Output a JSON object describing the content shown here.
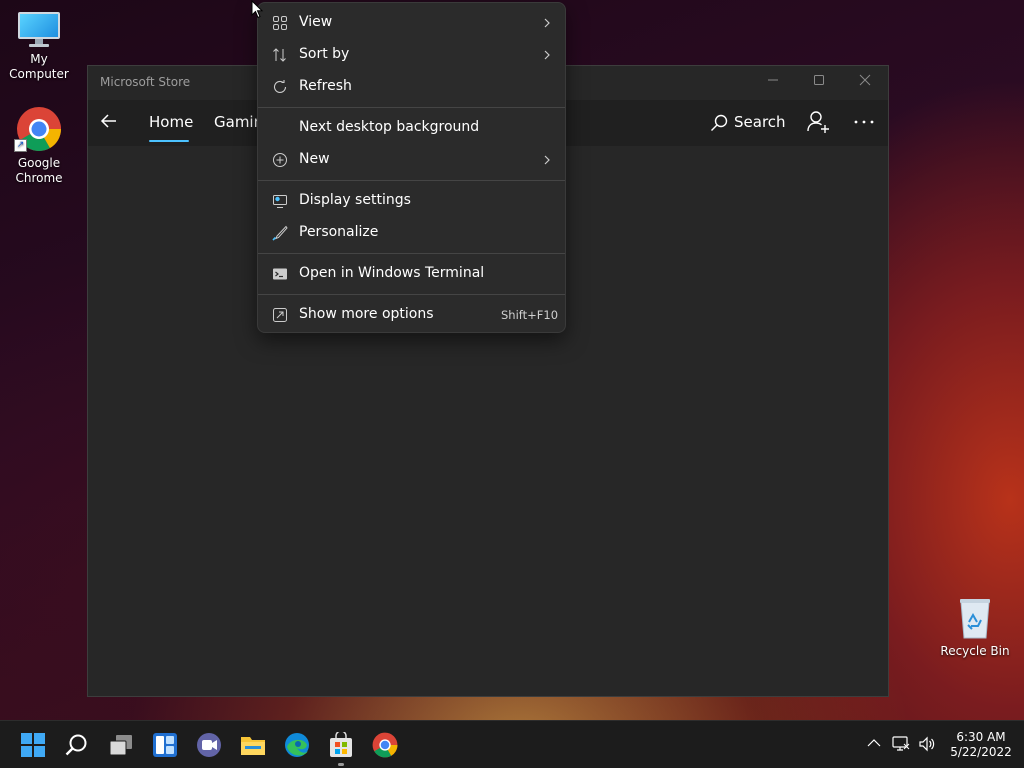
{
  "desktop": {
    "icons": [
      {
        "label": "My Computer"
      },
      {
        "label": "Google Chrome"
      },
      {
        "label": "Recycle Bin"
      }
    ]
  },
  "store_window": {
    "title": "Microsoft Store",
    "tabs": [
      {
        "label": "Home",
        "selected": true
      },
      {
        "label": "Gamin"
      }
    ],
    "search_label": "Search",
    "accent_color": "#4cc2ff"
  },
  "context_menu": {
    "items": [
      {
        "label": "View",
        "icon": "grid-view-icon",
        "submenu": true
      },
      {
        "label": "Sort by",
        "icon": "sort-icon",
        "submenu": true
      },
      {
        "label": "Refresh",
        "icon": "refresh-icon"
      },
      {
        "label": "Next desktop background"
      },
      {
        "label": "New",
        "icon": "plus-circle-icon",
        "submenu": true
      },
      {
        "label": "Display settings",
        "icon": "display-settings-icon"
      },
      {
        "label": "Personalize",
        "icon": "brush-icon"
      },
      {
        "label": "Open in Windows Terminal",
        "icon": "terminal-icon"
      },
      {
        "label": "Show more options",
        "icon": "more-options-icon",
        "shortcut": "Shift+F10"
      }
    ]
  },
  "taskbar": {
    "apps": [
      "start-icon",
      "search-icon",
      "task-view-icon",
      "widgets-icon",
      "chat-icon",
      "file-explorer-icon",
      "edge-icon",
      "store-icon",
      "chrome-icon"
    ],
    "clock": {
      "time": "6:30 AM",
      "date": "5/22/2022"
    }
  }
}
